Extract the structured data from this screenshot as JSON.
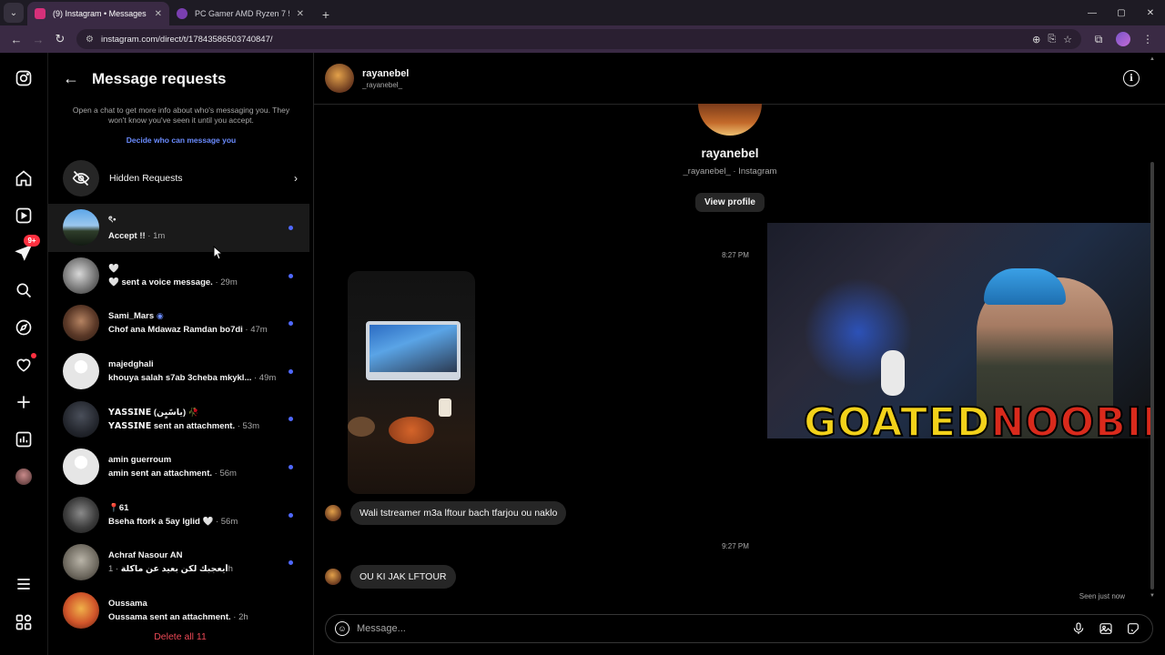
{
  "browser": {
    "tabs": [
      {
        "title": "(9) Instagram • Messages",
        "active": true,
        "favicon_color": "#d6307a"
      },
      {
        "title": "PC Gamer AMD Ryzen 7 5700X",
        "active": false,
        "favicon_color": "#7a3fb0"
      }
    ],
    "url": "instagram.com/direct/t/17843586503740847/"
  },
  "rail": {
    "notifications_badge": "9+"
  },
  "requests": {
    "title": "Message requests",
    "info": "Open a chat to get more info about who's messaging you. They won't know you've seen it until you accept.",
    "link": "Decide who can message you",
    "hidden_label": "Hidden Requests",
    "items": [
      {
        "name": "ৎ•",
        "preview": "Accept !!",
        "time": " · 1m",
        "avatar": "linear-gradient(180deg,#5da6e8 0%,#9cc8ee 45%,#2e3d2a 60%,#121a12 100%)"
      },
      {
        "name": "🤍",
        "preview": "🤍 sent a voice message.",
        "time": " · 29m",
        "avatar": "radial-gradient(circle at 45% 45%,#d8d8d8,#6e6e6e 60%,#2b2b2b)"
      },
      {
        "name": "Sami_Mars",
        "verified": "◉",
        "preview": "Chof ana Mdawaz Ramdan bo7di",
        "time": " · 47m",
        "avatar": "radial-gradient(circle at 50% 45%,#b58362,#5a3827 55%,#2a1b14)"
      },
      {
        "name": "majedghali",
        "preview": "khouya salah s7ab 3cheba mkykl...",
        "time": " · 49m",
        "avatar": "radial-gradient(circle at 50% 38%,#ffffff 0 22%,#e6e6e6 23% 100%)"
      },
      {
        "name": "𝗬𝗔𝗦𝗦𝗜𝗡𝗘 (يآسًيٍن) 🥀",
        "preview": "𝗬𝗔𝗦𝗦𝗜𝗡𝗘 sent an attachment.",
        "time": " · 53m",
        "avatar": "radial-gradient(circle at 50% 40%,#4a4f5a,#23262d 60%,#101114)"
      },
      {
        "name": "amin guerroum",
        "preview": "amin sent an attachment.",
        "time": " · 56m",
        "avatar": "radial-gradient(circle at 50% 38%,#ffffff 0 22%,#e6e6e6 23% 100%)"
      },
      {
        "name": "📍61",
        "preview": "Bseha ftork a 5ay lglid 🤍",
        "time": " · 56m",
        "avatar": "radial-gradient(circle at 50% 45%,#8a8a8a,#3d3d3d 55%,#151515)"
      },
      {
        "name": "Achraf Nasour AN",
        "preview": "أيعجبك لكن بعيد عن ماكلة",
        "time": " · 1h",
        "avatar": "radial-gradient(circle at 50% 45%,#b9b4a8,#6d685e 60%,#2c2a25)"
      },
      {
        "name": "Oussama",
        "preview": "Oussama sent an attachment.",
        "time": " · 2h",
        "avatar": "radial-gradient(circle at 50% 45%,#f0b14a,#d0552a 55%,#5a1f10)"
      }
    ],
    "delete_all": "Delete all 11"
  },
  "chat": {
    "name": "rayanebel",
    "username": "_rayanebel_",
    "profile_sub": "_rayanebel_ · Instagram",
    "view_profile": "View profile",
    "time1": "8:27 PM",
    "time2": "9:27 PM",
    "messages": [
      "Wali tstreamer m3a lftour bach tfarjou ou naklo",
      "OU KI JAK LFTOUR"
    ],
    "stream_logo_a": "GOATED",
    "stream_logo_b": "NOOBIE",
    "seen": "Seen just now",
    "composer_placeholder": "Message..."
  }
}
